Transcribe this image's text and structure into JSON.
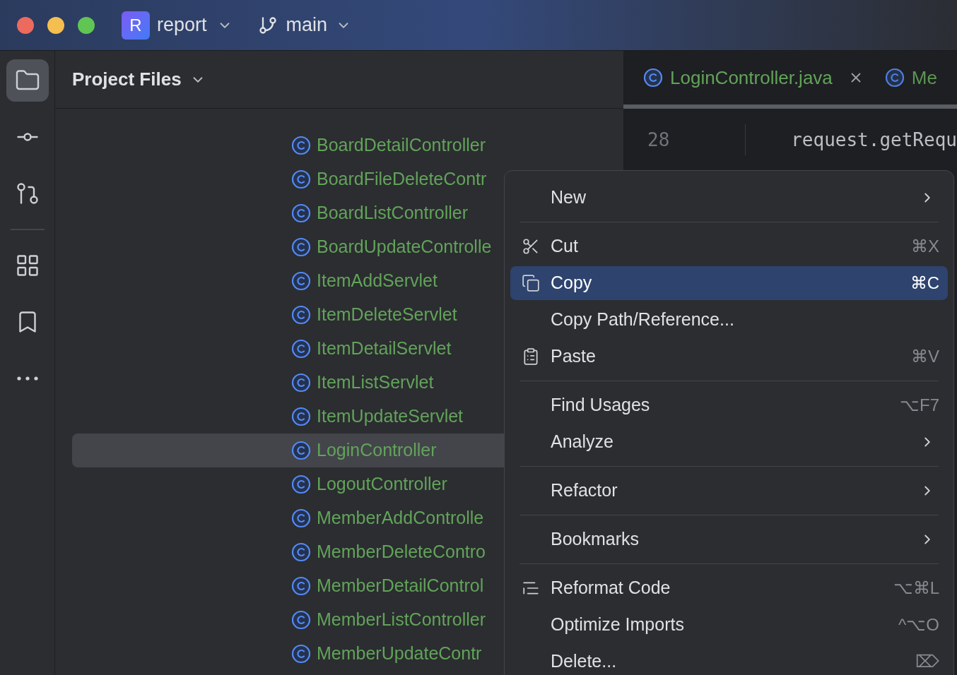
{
  "title_bar": {
    "project_initial": "R",
    "project": "report",
    "branch": "main"
  },
  "toolbar": [
    {
      "kind": "folder",
      "selected": true
    },
    {
      "kind": "commit",
      "selected": false
    },
    {
      "kind": "pull",
      "selected": false
    },
    {
      "kind": "divider"
    },
    {
      "kind": "structure",
      "selected": false
    },
    {
      "kind": "bookmark",
      "selected": false
    },
    {
      "kind": "more",
      "selected": false
    }
  ],
  "panel": {
    "title": "Project Files",
    "files": [
      {
        "name": "BoardDetailController",
        "selected": false
      },
      {
        "name": "BoardFileDeleteContr",
        "selected": false
      },
      {
        "name": "BoardListController",
        "selected": false
      },
      {
        "name": "BoardUpdateControlle",
        "selected": false
      },
      {
        "name": "ItemAddServlet",
        "selected": false
      },
      {
        "name": "ItemDeleteServlet",
        "selected": false
      },
      {
        "name": "ItemDetailServlet",
        "selected": false
      },
      {
        "name": "ItemListServlet",
        "selected": false
      },
      {
        "name": "ItemUpdateServlet",
        "selected": false
      },
      {
        "name": "LoginController",
        "selected": true
      },
      {
        "name": "LogoutController",
        "selected": false
      },
      {
        "name": "MemberAddControlle",
        "selected": false
      },
      {
        "name": "MemberDeleteContro",
        "selected": false
      },
      {
        "name": "MemberDetailControl",
        "selected": false
      },
      {
        "name": "MemberListController",
        "selected": false
      },
      {
        "name": "MemberUpdateContr",
        "selected": false
      }
    ]
  },
  "editor": {
    "tabs": [
      {
        "label": "LoginController.java",
        "selected": true,
        "closable": true
      },
      {
        "label": "Me",
        "selected": false,
        "closable": false
      }
    ],
    "lines": [
      {
        "number": "28",
        "code": "request.getRequ"
      }
    ]
  },
  "context_menu": [
    {
      "kind": "item",
      "label": "New",
      "submenu": true,
      "selected": false
    },
    {
      "kind": "separator"
    },
    {
      "kind": "cut",
      "label": "Cut",
      "shortcut": "⌘X",
      "selected": false
    },
    {
      "kind": "copy",
      "label": "Copy",
      "shortcut": "⌘C",
      "selected": true
    },
    {
      "kind": "item",
      "label": "Copy Path/Reference...",
      "selected": false
    },
    {
      "kind": "paste",
      "label": "Paste",
      "shortcut": "⌘V",
      "selected": false
    },
    {
      "kind": "separator"
    },
    {
      "kind": "item",
      "label": "Find Usages",
      "shortcut": "⌥F7",
      "selected": false
    },
    {
      "kind": "item",
      "label": "Analyze",
      "submenu": true,
      "selected": false
    },
    {
      "kind": "separator"
    },
    {
      "kind": "item",
      "label": "Refactor",
      "submenu": true,
      "selected": false
    },
    {
      "kind": "separator"
    },
    {
      "kind": "item",
      "label": "Bookmarks",
      "submenu": true,
      "selected": false
    },
    {
      "kind": "separator"
    },
    {
      "kind": "reformat",
      "label": "Reformat Code",
      "shortcut": "⌥⌘L",
      "selected": false
    },
    {
      "kind": "item",
      "label": "Optimize Imports",
      "shortcut": "^⌥O",
      "selected": false
    },
    {
      "kind": "item",
      "label": "Delete...",
      "shortcut": "⌦",
      "selected": false
    }
  ]
}
